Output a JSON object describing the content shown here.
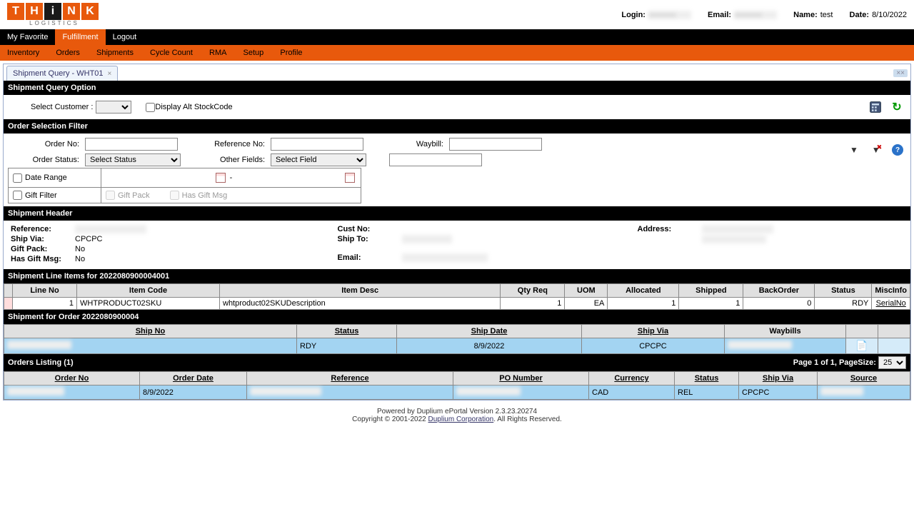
{
  "logo": {
    "letters": [
      "T",
      "H",
      "I",
      "N",
      "K"
    ],
    "sub": "LOGISTICS"
  },
  "userbar": {
    "login_lbl": "Login:",
    "email_lbl": "Email:",
    "name_lbl": "Name:",
    "name_val": "test",
    "date_lbl": "Date:",
    "date_val": "8/10/2022"
  },
  "nav1": {
    "fav": "My Favorite",
    "fulfill": "Fulfillment",
    "logout": "Logout"
  },
  "nav2": [
    "Inventory",
    "Orders",
    "Shipments",
    "Cycle Count",
    "RMA",
    "Setup",
    "Profile"
  ],
  "tab": {
    "title": "Shipment Query - WHT01",
    "close": "×",
    "strip_close": "××"
  },
  "sec": {
    "query": "Shipment Query Option",
    "filter": "Order Selection Filter",
    "header": "Shipment Header",
    "lines": "Shipment Line Items for 2022080900004001",
    "ship": "Shipment for Order 2022080900004"
  },
  "query": {
    "select_cust_lbl": "Select Customer :",
    "alt_stock_lbl": "Display Alt StockCode"
  },
  "filter": {
    "order_no_lbl": "Order No:",
    "ref_no_lbl": "Reference No:",
    "waybill_lbl": "Waybill:",
    "order_status_lbl": "Order Status:",
    "order_status_sel": "Select Status",
    "other_fields_lbl": "Other Fields:",
    "other_fields_sel": "Select Field",
    "date_range_lbl": "Date Range",
    "date_sep": "-",
    "gift_filter_lbl": "Gift Filter",
    "gift_pack_lbl": "Gift Pack",
    "has_gift_msg_lbl": "Has Gift Msg"
  },
  "header": {
    "reference_lbl": "Reference:",
    "ship_via_lbl": "Ship Via:",
    "ship_via_val": "CPCPC",
    "gift_pack_lbl": "Gift Pack:",
    "gift_pack_val": "No",
    "has_gift_msg_lbl": "Has Gift Msg:",
    "has_gift_msg_val": "No",
    "cust_no_lbl": "Cust No:",
    "ship_to_lbl": "Ship To:",
    "email_lbl": "Email:",
    "address_lbl": "Address:"
  },
  "lines": {
    "cols": [
      "Line No",
      "Item Code",
      "Item Desc",
      "Qty Req",
      "UOM",
      "Allocated",
      "Shipped",
      "BackOrder",
      "Status",
      "MiscInfo"
    ],
    "row": {
      "line_no": "1",
      "item_code": "WHTPRODUCT02SKU",
      "item_desc": "whtproduct02SKUDescription",
      "qty_req": "1",
      "uom": "EA",
      "allocated": "1",
      "shipped": "1",
      "backorder": "0",
      "status": "RDY",
      "miscinfo": "SerialNo"
    }
  },
  "ship": {
    "cols": [
      "Ship No",
      "Status",
      "Ship Date",
      "Ship Via",
      "Waybills",
      ""
    ],
    "row": {
      "status": "RDY",
      "ship_date": "8/9/2022",
      "ship_via": "CPCPC"
    }
  },
  "orders": {
    "title": "Orders Listing (1)",
    "page_text": "Page 1 of 1, PageSize: ",
    "page_size": "25",
    "cols": [
      "Order No",
      "Order Date",
      "Reference",
      "PO Number",
      "Currency",
      "Status",
      "Ship Via",
      "Source"
    ],
    "row": {
      "order_date": "8/9/2022",
      "currency": "CAD",
      "status": "REL",
      "ship_via": "CPCPC"
    }
  },
  "footer": {
    "line1": "Powered by Duplium ePortal Version 2.3.23.20274",
    "line2a": "Copyright © 2001-2022 ",
    "line2b": "Duplium Corporation",
    "line2c": ". All Rights Reserved."
  }
}
